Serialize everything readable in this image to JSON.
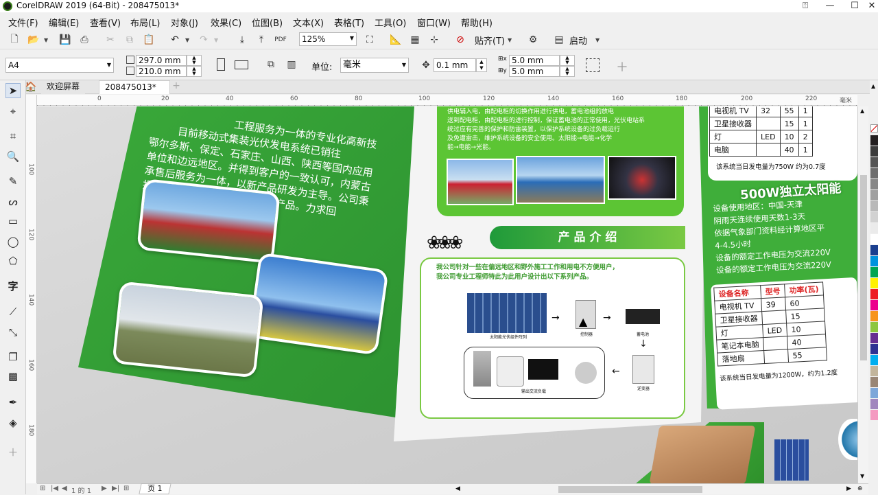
{
  "window": {
    "title": "CorelDRAW 2019 (64-Bit) - 208475013*"
  },
  "menu": [
    "文件(F)",
    "编辑(E)",
    "查看(V)",
    "布局(L)",
    "对象(J)",
    "效果(C)",
    "位图(B)",
    "文本(X)",
    "表格(T)",
    "工具(O)",
    "窗口(W)",
    "帮助(H)"
  ],
  "toolbar": {
    "zoom": "125%",
    "snap_label": "贴齐(T)",
    "launch_label": "启动"
  },
  "property_bar": {
    "page_size": "A4",
    "width": "297.0 mm",
    "height": "210.0 mm",
    "unit_label": "单位:",
    "unit_value": "毫米",
    "nudge": "0.1 mm",
    "dup_x": "5.0 mm",
    "dup_y": "5.0 mm"
  },
  "tabs": {
    "welcome": "欢迎屏幕",
    "document": "208475013*"
  },
  "ruler": {
    "h_ticks": [
      "0",
      "20",
      "40",
      "60",
      "80",
      "100",
      "120",
      "140",
      "160",
      "180",
      "200",
      "220"
    ],
    "unit": "毫米",
    "v_ticks": [
      "100",
      "120",
      "140",
      "160",
      "180",
      "200"
    ]
  },
  "page_nav": {
    "counter": "1 的 1",
    "page_tab": "页 1"
  },
  "palette": [
    "#231f20",
    "#3c3c3c",
    "#555555",
    "#6e6e6e",
    "#878787",
    "#a0a0a0",
    "#b9b9b9",
    "#d2d2d2",
    "#ebebeb",
    "#ffffff",
    "#1b3f8f",
    "#0093dd",
    "#00a651",
    "#fff200",
    "#ed1c24",
    "#ec008c",
    "#f7941d",
    "#8dc63f",
    "#662d91",
    "#2e3192",
    "#00aeef",
    "#c2b59b",
    "#998675",
    "#7da7d9",
    "#a187be",
    "#f49ac1"
  ],
  "brochure": {
    "left_text": [
      "目前移动式集装光伏发电系统已销往",
      "鄂尔多斯、保定、石家庄、山西、陕西等国内应用",
      "单位和边远地区。并得到客户的一致认可，内蒙古",
      "承售后服务为一体，以新产品研发为主导。公司秉",
      "报一项品质优秀，服务完善的产品。力求回"
    ],
    "left_top_text": "工程服务为一体的专业化高新技",
    "middle_top_text": [
      "供电辅入电，由配电柜的切换作用进行供电，蓄电池组的放电",
      "送到配电柜，由配电柜的进行控制，保证蓄电池的正常使用，光伏电站系",
      "统过应有完善的保护和防雷装置，以保护系统设备的过负载运行",
      "及免遭雷击，维护系统设备的安全使用。太阳能→电能→化学",
      "能→电能→光能。"
    ],
    "product_title": "产 品 介 绍",
    "product_desc": [
      "我公司针对一些在偏远地区和野外施工工作和用电不方便用户，",
      "我公司专业工程师特此为此用户设计出以下系列产品。"
    ],
    "diagram_labels": {
      "array": "太阳能光伏组件阵列",
      "controller": "控制器",
      "battery": "蓄电池",
      "load": "输出交流负载",
      "inverter": "逆变器"
    },
    "right_table_top": {
      "rows": [
        [
          "电视机 TV",
          "32",
          "55",
          "1"
        ],
        [
          "卫星接收器",
          "",
          "15",
          "1"
        ],
        [
          "灯",
          "LED",
          "10",
          "2"
        ],
        [
          "电脑",
          "",
          "40",
          "1"
        ]
      ],
      "summary": "该系统当日发电量为750W  约为0.7度"
    },
    "right_heading": "500W独立太阳能",
    "right_specs": [
      "设备使用地区：中国-天津",
      "阴雨天连续使用天数1-3天",
      "依据气象部门资料经计算地区平",
      "4-4.5小时",
      "设备的额定工作电压为交流220V",
      "设备的额定工作电压为交流220V"
    ],
    "right_table": {
      "headers": [
        "设备名称",
        "型号",
        "功率(瓦)"
      ],
      "rows": [
        [
          "电视机 TV",
          "39",
          "60"
        ],
        [
          "卫星接收器",
          "",
          "15"
        ],
        [
          "灯",
          "LED",
          "10"
        ],
        [
          "笔记本电脑",
          "",
          "40"
        ],
        [
          "落地扇",
          "",
          "55"
        ]
      ],
      "summary": "该系统当日发电量为1200W，约为1.2度"
    }
  }
}
